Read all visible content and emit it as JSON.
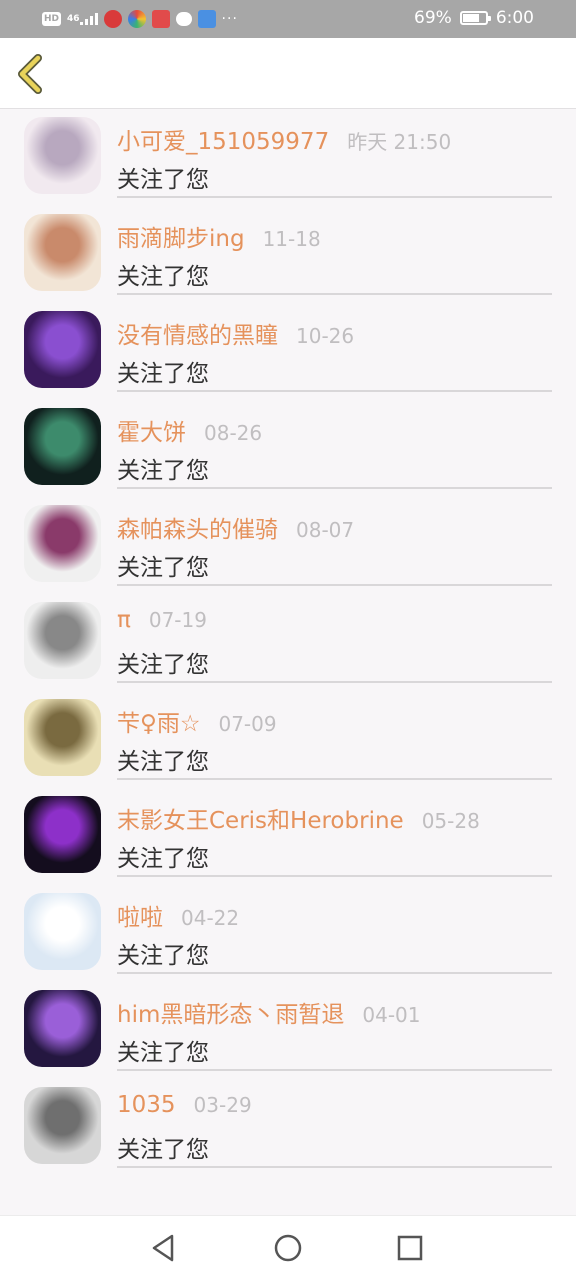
{
  "status_bar": {
    "network_label": "HD",
    "signal_label": "46",
    "more_label": "···",
    "battery_text": "69%",
    "battery_level": 0.69,
    "time": "6:00"
  },
  "header": {
    "back_icon": "chevron-left-icon"
  },
  "follows": [
    {
      "name": "小可爱_151059977",
      "time": "昨天 21:50",
      "action": "关注了您",
      "avatar_bg": "#f1e9ef",
      "avatar_fg": "#b8a8bf"
    },
    {
      "name": "雨滴脚步ing",
      "time": "11-18",
      "action": "关注了您",
      "avatar_bg": "#f2e5d6",
      "avatar_fg": "#c98a6b"
    },
    {
      "name": "没有情感的黑瞳",
      "time": "10-26",
      "action": "关注了您",
      "avatar_bg": "#3a1a5c",
      "avatar_fg": "#8a4fd0"
    },
    {
      "name": "霍大饼",
      "time": "08-26",
      "action": "关注了您",
      "avatar_bg": "#10201e",
      "avatar_fg": "#3d8b6c"
    },
    {
      "name": "森帕森头的催骑",
      "time": "08-07",
      "action": "关注了您",
      "avatar_bg": "#f0f0f0",
      "avatar_fg": "#8a3a6a"
    },
    {
      "name": "π",
      "time": "07-19",
      "action": "关注了您",
      "avatar_bg": "#eeeeee",
      "avatar_fg": "#888888"
    },
    {
      "name": "芐♀雨☆",
      "time": "07-09",
      "action": "关注了您",
      "avatar_bg": "#e9dfb5",
      "avatar_fg": "#7a6a40"
    },
    {
      "name": "末影女王Ceris和Herobrine",
      "time": "05-28",
      "action": "关注了您",
      "avatar_bg": "#140d1e",
      "avatar_fg": "#8d30c9"
    },
    {
      "name": "啦啦",
      "time": "04-22",
      "action": "关注了您",
      "avatar_bg": "#dce8f4",
      "avatar_fg": "#ffffff"
    },
    {
      "name": "him黑暗形态丶雨暂退",
      "time": "04-01",
      "action": "关注了您",
      "avatar_bg": "#241740",
      "avatar_fg": "#9a5fd8"
    },
    {
      "name": "1035",
      "time": "03-29",
      "action": "关注了您",
      "avatar_bg": "#d7d7d7",
      "avatar_fg": "#6f6f6f"
    }
  ],
  "nav": {
    "back_icon": "triangle-back-icon",
    "home_icon": "circle-home-icon",
    "recents_icon": "square-recents-icon"
  },
  "colors": {
    "name": "#e5925c",
    "time": "#c0bec0",
    "back_arrow": "#e8d35a"
  }
}
